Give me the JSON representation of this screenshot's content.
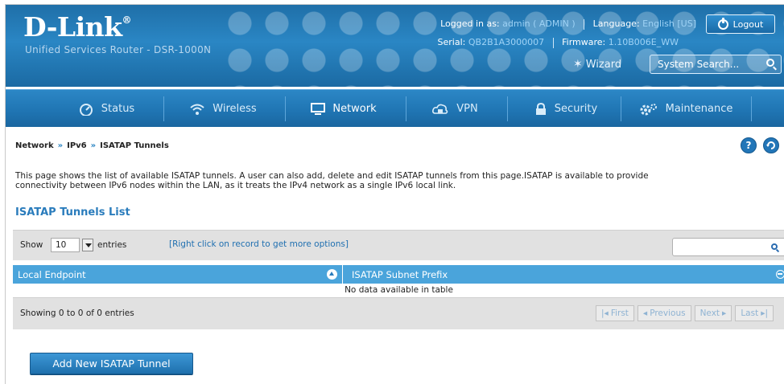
{
  "header": {
    "brand": "D-Link",
    "brand_mark": "®",
    "subtitle": "Unified Services Router - DSR-1000N",
    "logged_in_label": "Logged in as:",
    "logged_in_value": "admin ( ADMIN )",
    "language_label": "Language:",
    "language_value": "English [US]",
    "serial_label": "Serial:",
    "serial_value": "QB2B1A3000007",
    "firmware_label": "Firmware:",
    "firmware_value": "1.10B006E_WW",
    "logout_label": "Logout",
    "wizard_label": "Wizard",
    "search_placeholder": "System Search..."
  },
  "nav": {
    "items": [
      {
        "label": "Status",
        "icon": "dashboard-icon"
      },
      {
        "label": "Wireless",
        "icon": "wifi-icon"
      },
      {
        "label": "Network",
        "icon": "monitor-icon"
      },
      {
        "label": "VPN",
        "icon": "cloud-lock-icon"
      },
      {
        "label": "Security",
        "icon": "padlock-icon"
      },
      {
        "label": "Maintenance",
        "icon": "gears-icon"
      }
    ],
    "active": "Network"
  },
  "breadcrumb": [
    "Network",
    "IPv6",
    "ISATAP Tunnels"
  ],
  "breadcrumb_sep": "»",
  "help_icon": "?",
  "description": {
    "line1": "This page shows the list of available ISATAP tunnels. A user can also add, delete and edit ISATAP tunnels from this page.ISATAP is available to provide",
    "line2": "connectivity between IPv6 nodes within the LAN, as it treats the IPv4 network as a single IPv6 local link."
  },
  "list_title": "ISATAP Tunnels List",
  "table": {
    "show_label": "Show",
    "show_value": "10",
    "entries_label": "entries",
    "hint": "[Right click on record to get more options]",
    "columns": [
      "Local Endpoint",
      "ISATAP Subnet Prefix"
    ],
    "empty_message": "No data available in table",
    "showing": "Showing 0 to 0 of 0 entries",
    "pager": {
      "first": "First",
      "previous": "Previous",
      "next": "Next",
      "last": "Last"
    }
  },
  "add_button": "Add New ISATAP Tunnel",
  "colors": {
    "brand_blue": "#2a86c4",
    "table_header": "#4aa4db",
    "title_blue": "#2a7cbc"
  }
}
